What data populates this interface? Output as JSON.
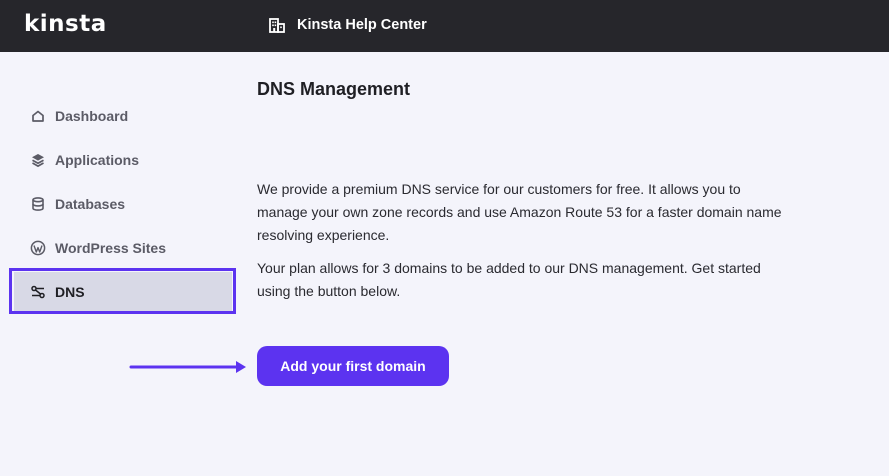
{
  "header": {
    "logo_text": "kinsta",
    "help_center_label": "Kinsta Help Center"
  },
  "sidebar": {
    "items": [
      {
        "label": "Dashboard",
        "icon": "home-icon"
      },
      {
        "label": "Applications",
        "icon": "layers-icon"
      },
      {
        "label": "Databases",
        "icon": "database-icon"
      },
      {
        "label": "WordPress Sites",
        "icon": "wordpress-icon"
      },
      {
        "label": "DNS",
        "icon": "dns-icon",
        "active": true
      }
    ]
  },
  "main": {
    "title": "DNS Management",
    "description": "We provide a premium DNS service for our customers for free. It allows you to manage your own zone records and use Amazon Route 53 for a faster domain name resolving experience.",
    "plan_info": "Your plan allows for 3 domains to be added to our DNS management. Get started using the button below.",
    "cta_label": "Add your first domain"
  },
  "colors": {
    "accent": "#5c33f0",
    "topbar": "#26262b",
    "background": "#f4f4fb",
    "active_item_bg": "#d8d9e6"
  }
}
